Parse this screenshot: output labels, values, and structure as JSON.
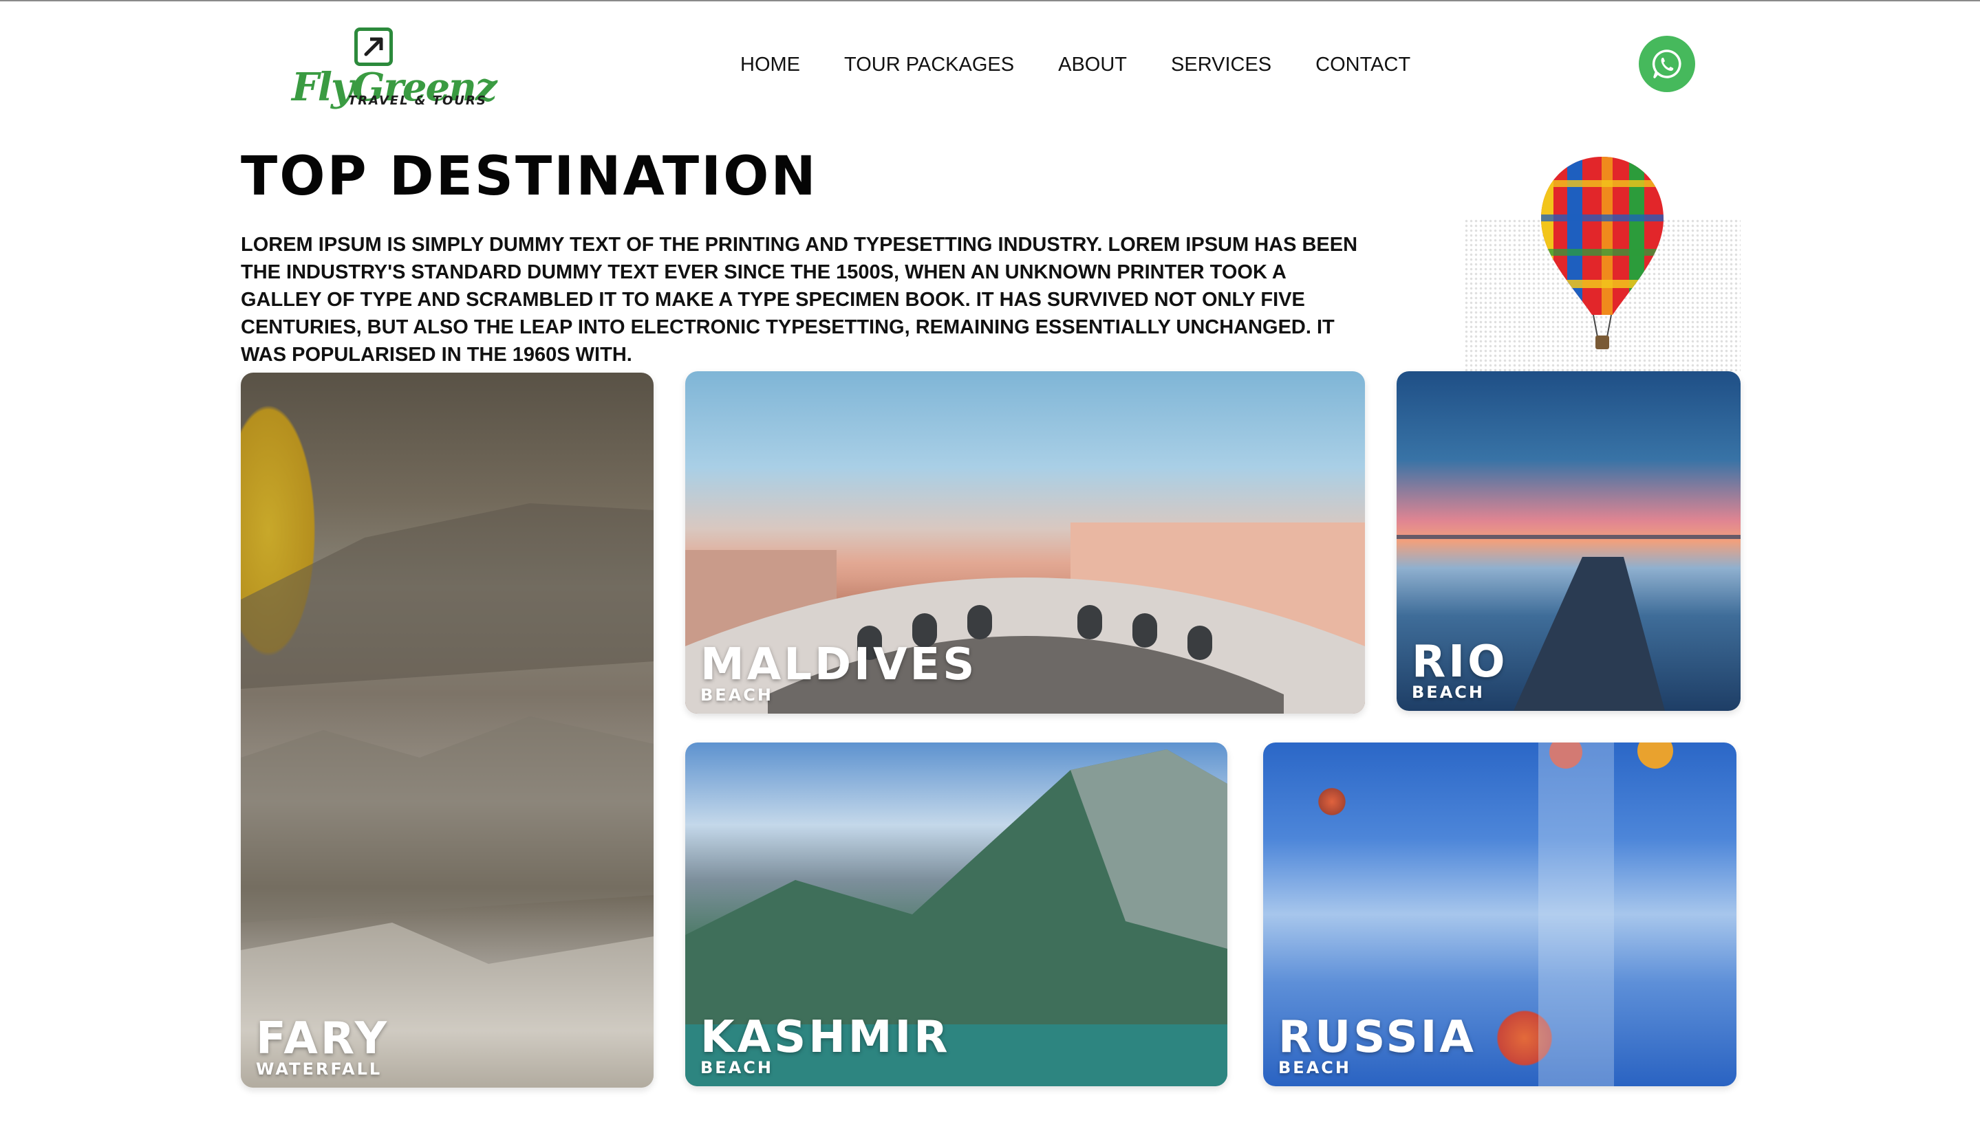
{
  "brand": {
    "name": "FlyGreenz",
    "tagline": "TRAVEL & TOURS"
  },
  "nav": {
    "items": [
      {
        "label": "HOME"
      },
      {
        "label": "TOUR PACKAGES"
      },
      {
        "label": "ABOUT"
      },
      {
        "label": "SERVICES"
      },
      {
        "label": "CONTACT"
      }
    ]
  },
  "whatsapp": {
    "icon": "whatsapp-icon",
    "color": "#46b95c"
  },
  "section": {
    "title": "TOP DESTINATION",
    "description": "LOREM IPSUM IS SIMPLY DUMMY TEXT OF THE PRINTING AND TYPESETTING INDUSTRY. LOREM IPSUM HAS BEEN THE INDUSTRY'S STANDARD DUMMY TEXT EVER SINCE THE 1500S, WHEN AN UNKNOWN PRINTER TOOK A GALLEY OF TYPE AND SCRAMBLED IT TO MAKE A TYPE SPECIMEN BOOK. IT HAS SURVIVED NOT ONLY FIVE CENTURIES, BUT ALSO THE LEAP INTO ELECTRONIC TYPESETTING, REMAINING ESSENTIALLY UNCHANGED. IT WAS POPULARISED IN THE 1960S WITH."
  },
  "destinations": [
    {
      "name": "FARY",
      "type": "WATERFALL"
    },
    {
      "name": "MALDIVES",
      "type": "BEACH"
    },
    {
      "name": "RIO",
      "type": "BEACH"
    },
    {
      "name": "KASHMIR",
      "type": "BEACH"
    },
    {
      "name": "RUSSIA",
      "type": "BEACH"
    }
  ],
  "colors": {
    "brand_green": "#3a9b42",
    "whatsapp_green": "#46b95c",
    "text": "#111111"
  }
}
